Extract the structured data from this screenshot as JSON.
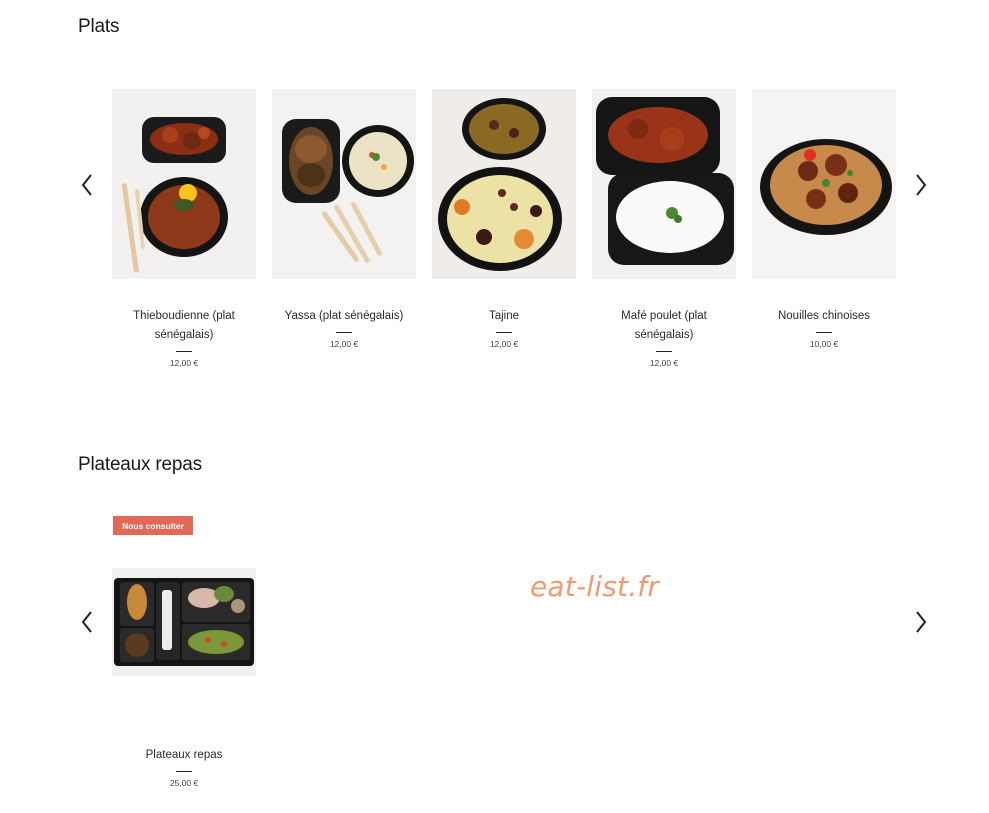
{
  "sections": {
    "plats": {
      "title": "Plats",
      "items": [
        {
          "name": "Thieboudienne (plat sénégalais)",
          "price": "12,00 €"
        },
        {
          "name": "Yassa (plat sénégalais)",
          "price": "12,00 €"
        },
        {
          "name": "Tajine",
          "price": "12,00 €"
        },
        {
          "name": "Mafé poulet (plat sénégalais)",
          "price": "12,00 €"
        },
        {
          "name": "Nouilles chinoises",
          "price": "10,00 €"
        }
      ]
    },
    "plateaux": {
      "title": "Plateaux repas",
      "badge": "Nous consulter",
      "items": [
        {
          "name": "Plateaux repas",
          "price": "25,00 €"
        }
      ]
    }
  },
  "watermark": "eat-list.fr",
  "icons": {
    "prev": "chevron-left-icon",
    "next": "chevron-right-icon"
  },
  "colors": {
    "badge": "#e06a57",
    "watermark": "#ef9a6e"
  }
}
